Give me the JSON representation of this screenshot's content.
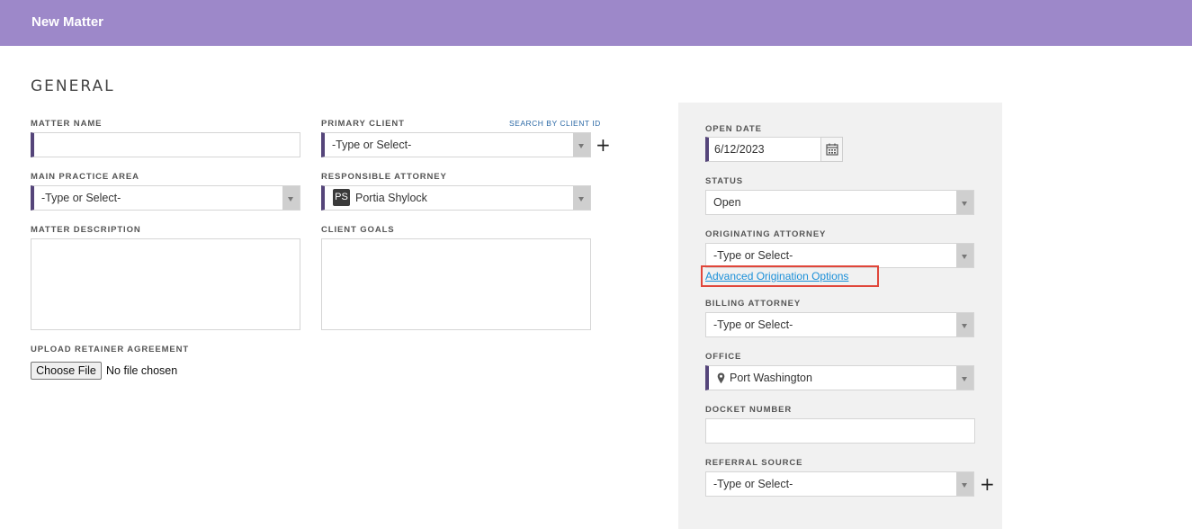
{
  "header": {
    "title": "New Matter"
  },
  "section": {
    "title": "GENERAL"
  },
  "left": {
    "matter_name": {
      "label": "MATTER NAME",
      "value": ""
    },
    "primary_client": {
      "label": "PRIMARY CLIENT",
      "search_link": "SEARCH BY CLIENT ID",
      "value": "-Type or Select-"
    },
    "main_practice_area": {
      "label": "MAIN PRACTICE AREA",
      "value": "-Type or Select-"
    },
    "responsible_attorney": {
      "label": "RESPONSIBLE ATTORNEY",
      "initials": "PS",
      "value": "Portia Shylock"
    },
    "matter_description": {
      "label": "MATTER DESCRIPTION"
    },
    "client_goals": {
      "label": "CLIENT GOALS"
    },
    "upload": {
      "label": "UPLOAD RETAINER AGREEMENT",
      "button": "Choose File",
      "status": "No file chosen"
    }
  },
  "right": {
    "open_date": {
      "label": "OPEN DATE",
      "value": "6/12/2023"
    },
    "status": {
      "label": "STATUS",
      "value": "Open"
    },
    "originating_attorney": {
      "label": "ORIGINATING ATTORNEY",
      "value": "-Type or Select-",
      "advanced_link": "Advanced Origination Options"
    },
    "billing_attorney": {
      "label": "BILLING ATTORNEY",
      "value": "-Type or Select-"
    },
    "office": {
      "label": "OFFICE",
      "value": "Port Washington"
    },
    "docket_number": {
      "label": "DOCKET NUMBER",
      "value": ""
    },
    "referral_source": {
      "label": "REFERRAL SOURCE",
      "value": "-Type or Select-"
    }
  },
  "icons": {
    "add": "plus-icon",
    "calendar": "calendar-icon",
    "location": "map-pin-icon",
    "dropdown": "triangle-down-icon"
  },
  "colors": {
    "header": "#9d88c9",
    "required_bar": "#55457a",
    "link": "#1a8fd8",
    "highlight": "#e0463a",
    "panel": "#f1f1f1"
  }
}
